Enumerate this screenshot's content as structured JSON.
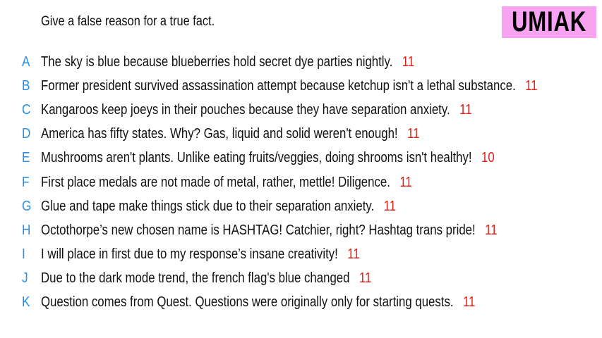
{
  "header": {
    "prompt": "Give a false reason for a true fact.",
    "badge": "UMIAK",
    "badge_color": "#f7a3f1"
  },
  "colors": {
    "letter": "#2a8fe0",
    "score": "#e0201a",
    "text": "#111111"
  },
  "answers": [
    {
      "letter": "A",
      "text": "The sky is blue because blueberries hold secret dye parties nightly.",
      "score": "11"
    },
    {
      "letter": "B",
      "text": "Former president survived assassination attempt because ketchup isn't a lethal substance.",
      "score": "11"
    },
    {
      "letter": "C",
      "text": "Kangaroos keep joeys in their pouches because they have separation anxiety.",
      "score": "11"
    },
    {
      "letter": "D",
      "text": "America has fifty states. Why? Gas, liquid and solid weren't enough!",
      "score": "11"
    },
    {
      "letter": "E",
      "text": "Mushrooms aren't plants. Unlike eating fruits/veggies, doing shrooms isn't healthy!",
      "score": "10"
    },
    {
      "letter": "F",
      "text": "First place medals are not made of metal, rather, mettle! Diligence.",
      "score": "11"
    },
    {
      "letter": "G",
      "text": "Glue and tape make things stick due to their separation anxiety.",
      "score": "11"
    },
    {
      "letter": "H",
      "text": "Octothorpe’s new chosen name is HASHTAG! Catchier, right? Hashtag trans pride!",
      "score": "11"
    },
    {
      "letter": "I",
      "text": "I will place in first due to my response’s insane creativity!",
      "score": "11"
    },
    {
      "letter": "J",
      "text": "Due to the dark mode trend, the french flag's blue changed",
      "score": "11"
    },
    {
      "letter": "K",
      "text": "Question comes from Quest. Questions were originally only for starting quests.",
      "score": "11"
    }
  ]
}
